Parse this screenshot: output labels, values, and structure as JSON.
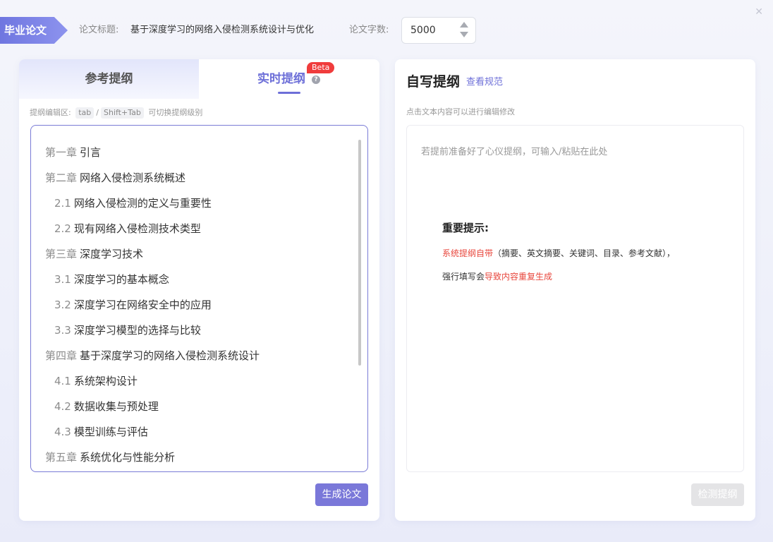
{
  "window": {
    "close_icon": "close-icon"
  },
  "header": {
    "badge": "毕业论文",
    "title_label": "论文标题:",
    "title_value": "基于深度学习的网络入侵检测系统设计与优化",
    "count_label": "论文字数:",
    "count_value": "5000"
  },
  "left": {
    "tabs": [
      {
        "label": "参考提纲",
        "active": false
      },
      {
        "label": "实时提纲",
        "active": true,
        "badge": "Beta"
      }
    ],
    "hint_prefix": "提纲编辑区:",
    "hint_key1": "tab",
    "hint_sep": "/",
    "hint_key2": "Shift+Tab",
    "hint_suffix": "可切换提纲级别",
    "outline": [
      {
        "prefix": "第一章",
        "text": "引言",
        "level": 1
      },
      {
        "prefix": "第二章",
        "text": "网络入侵检测系统概述",
        "level": 1
      },
      {
        "prefix": "2.1",
        "text": "网络入侵检测的定义与重要性",
        "level": 2
      },
      {
        "prefix": "2.2",
        "text": "现有网络入侵检测技术类型",
        "level": 2
      },
      {
        "prefix": "第三章",
        "text": "深度学习技术",
        "level": 1
      },
      {
        "prefix": "3.1",
        "text": "深度学习的基本概念",
        "level": 2
      },
      {
        "prefix": "3.2",
        "text": "深度学习在网络安全中的应用",
        "level": 2
      },
      {
        "prefix": "3.3",
        "text": "深度学习模型的选择与比较",
        "level": 2
      },
      {
        "prefix": "第四章",
        "text": "基于深度学习的网络入侵检测系统设计",
        "level": 1
      },
      {
        "prefix": "4.1",
        "text": "系统架构设计",
        "level": 2
      },
      {
        "prefix": "4.2",
        "text": "数据收集与预处理",
        "level": 2
      },
      {
        "prefix": "4.3",
        "text": "模型训练与评估",
        "level": 2
      },
      {
        "prefix": "第五章",
        "text": "系统优化与性能分析",
        "level": 1
      }
    ],
    "generate_button": "生成论文"
  },
  "right": {
    "title": "自写提纲",
    "link": "查看规范",
    "hint": "点击文本内容可以进行编辑修改",
    "placeholder": "若提前准备好了心仪提纲，可输入/粘贴在此处",
    "important_title": "重要提示:",
    "line1_red": "系统提纲自带",
    "line1_rest": "（摘要、英文摘要、关键词、目录、参考文献），",
    "line2_start": "强行填写会",
    "line2_red": "导致内容重复生成",
    "check_button": "检测提纲"
  },
  "colors": {
    "accent": "#6d6fd8",
    "button": "#7a78d9",
    "beta": "#f03c3c",
    "warning": "#e8473d",
    "disabled": "#e4e4e6"
  }
}
